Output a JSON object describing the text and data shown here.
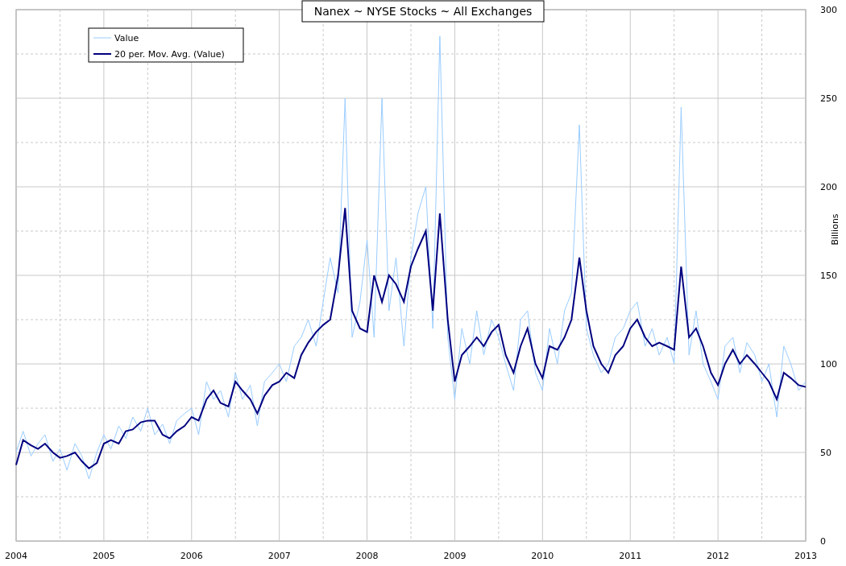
{
  "chart_data": {
    "type": "line",
    "title": "Nanex ~ NYSE Stocks ~ All Exchanges",
    "ylabel": "Billions",
    "x": [
      2004,
      2004.08,
      2004.17,
      2004.25,
      2004.33,
      2004.42,
      2004.5,
      2004.58,
      2004.67,
      2004.75,
      2004.83,
      2004.92,
      2005,
      2005.08,
      2005.17,
      2005.25,
      2005.33,
      2005.42,
      2005.5,
      2005.58,
      2005.67,
      2005.75,
      2005.83,
      2005.92,
      2006,
      2006.08,
      2006.17,
      2006.25,
      2006.33,
      2006.42,
      2006.5,
      2006.58,
      2006.67,
      2006.75,
      2006.83,
      2006.92,
      2007,
      2007.08,
      2007.17,
      2007.25,
      2007.33,
      2007.42,
      2007.5,
      2007.58,
      2007.67,
      2007.75,
      2007.83,
      2007.92,
      2008,
      2008.08,
      2008.17,
      2008.25,
      2008.33,
      2008.42,
      2008.5,
      2008.58,
      2008.67,
      2008.75,
      2008.83,
      2008.92,
      2009,
      2009.08,
      2009.17,
      2009.25,
      2009.33,
      2009.42,
      2009.5,
      2009.58,
      2009.67,
      2009.75,
      2009.83,
      2009.92,
      2010,
      2010.08,
      2010.17,
      2010.25,
      2010.33,
      2010.42,
      2010.5,
      2010.58,
      2010.67,
      2010.75,
      2010.83,
      2010.92,
      2011,
      2011.08,
      2011.17,
      2011.25,
      2011.33,
      2011.42,
      2011.5,
      2011.58,
      2011.67,
      2011.75,
      2011.83,
      2011.92,
      2012,
      2012.08,
      2012.17,
      2012.25,
      2012.33,
      2012.42,
      2012.5,
      2012.58,
      2012.67,
      2012.75,
      2012.83,
      2012.92,
      2013
    ],
    "series": [
      {
        "name": "Value",
        "color": "#99ccff",
        "values": [
          50,
          62,
          48,
          55,
          60,
          45,
          52,
          40,
          55,
          48,
          35,
          50,
          60,
          52,
          65,
          58,
          70,
          62,
          75,
          60,
          66,
          55,
          68,
          72,
          75,
          60,
          90,
          80,
          85,
          70,
          95,
          80,
          88,
          65,
          90,
          95,
          100,
          90,
          110,
          115,
          125,
          110,
          135,
          160,
          140,
          250,
          115,
          135,
          170,
          115,
          250,
          130,
          160,
          110,
          160,
          185,
          200,
          120,
          285,
          115,
          80,
          120,
          100,
          130,
          105,
          125,
          115,
          100,
          85,
          125,
          130,
          95,
          85,
          120,
          100,
          130,
          140,
          235,
          120,
          105,
          95,
          100,
          115,
          120,
          130,
          135,
          110,
          120,
          105,
          115,
          100,
          245,
          105,
          130,
          100,
          90,
          80,
          110,
          115,
          95,
          112,
          105,
          90,
          100,
          70,
          110,
          100,
          85,
          90
        ]
      },
      {
        "name": "20 per. Mov. Avg. (Value)",
        "color": "#000080",
        "values": [
          43,
          57,
          54,
          52,
          55,
          50,
          47,
          48,
          50,
          45,
          41,
          44,
          55,
          57,
          55,
          62,
          63,
          67,
          68,
          68,
          60,
          58,
          62,
          65,
          70,
          68,
          80,
          85,
          78,
          76,
          90,
          85,
          80,
          72,
          82,
          88,
          90,
          95,
          92,
          105,
          112,
          118,
          122,
          125,
          150,
          188,
          130,
          120,
          118,
          150,
          135,
          150,
          145,
          135,
          155,
          165,
          175,
          130,
          185,
          125,
          90,
          105,
          110,
          115,
          110,
          118,
          122,
          105,
          95,
          110,
          120,
          100,
          92,
          110,
          108,
          115,
          125,
          160,
          130,
          110,
          100,
          95,
          105,
          110,
          120,
          125,
          115,
          110,
          112,
          110,
          108,
          155,
          115,
          120,
          110,
          95,
          88,
          100,
          108,
          100,
          105,
          100,
          95,
          90,
          80,
          95,
          92,
          88,
          87
        ]
      }
    ],
    "xlim": [
      2004,
      2013
    ],
    "ylim": [
      0,
      300
    ],
    "xticks": [
      2004,
      2005,
      2006,
      2007,
      2008,
      2009,
      2010,
      2011,
      2012,
      2013
    ],
    "yticks": [
      0,
      50,
      100,
      150,
      200,
      250,
      300
    ],
    "grid": true,
    "legend": true
  }
}
